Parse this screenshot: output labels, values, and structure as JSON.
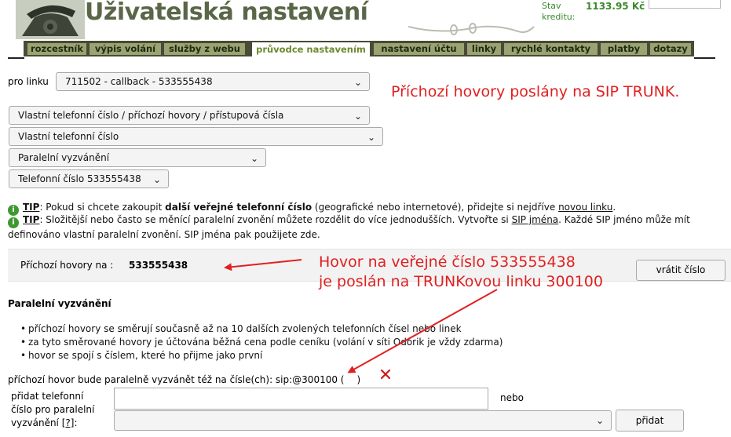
{
  "header": {
    "title": "Uživatelská nastavení",
    "credit_label": "Stav kreditu:",
    "credit_value": "1133.95 Kč"
  },
  "nav": {
    "tabs": [
      {
        "label": "rozcestník"
      },
      {
        "label": "výpis volání"
      },
      {
        "label": "služby z webu"
      },
      {
        "label": "průvodce nastavením",
        "active": true
      },
      {
        "label": "nastavení účtu"
      },
      {
        "label": "linky"
      },
      {
        "label": "rychlé kontakty"
      },
      {
        "label": "platby"
      },
      {
        "label": "dotazy"
      }
    ]
  },
  "line_select": {
    "label": "pro linku",
    "value": "711502 - callback - 533555438"
  },
  "annotation_top": "Příchozí hovory poslány na SIP TRUNK.",
  "wizard_selects": [
    {
      "value": "Vlastní telefonní číslo / příchozí hovory / přístupová čísla"
    },
    {
      "value": "Vlastní telefonní číslo"
    },
    {
      "value": "Paralelní vyzvánění"
    },
    {
      "value": "Telefonní číslo 533555438"
    }
  ],
  "tips": {
    "tip1": {
      "label": "TIP",
      "text_before": ": Pokud si chcete zakoupit ",
      "bold": "další veřejné telefonní číslo",
      "text_after": " (geografické nebo internetové), přidejte si nejdříve ",
      "link": "novou linku",
      "end": "."
    },
    "tip2": {
      "label": "TIP",
      "text_before": ": Složitější nebo často se měnící paralelní zvonění můžete rozdělit do více jednodušších. Vytvořte si ",
      "link": "SIP jména",
      "text_after": ". Každé SIP jméno může mít definováno vlastní paralelní zvonění. SIP jména pak použijete zde."
    }
  },
  "incoming": {
    "label": "Příchozí hovory na :",
    "number": "533555438",
    "return_button": "vrátit číslo"
  },
  "annotation_middle": {
    "line1": "Hovor na veřejné číslo 533555438",
    "line2": "je poslán na TRUNKovou linku 300100"
  },
  "parallel": {
    "title": "Paralelní vyzvánění",
    "bullets": [
      "příchozí hovory se směrují současně až na 10 dalších zvolených telefonních čísel nebo linek",
      "za tyto směrované hovory je účtována běžná cena podle ceníku (volání v síti Odorik je vždy zdarma)",
      "hovor se spojí s číslem, které ho přijme jako první"
    ],
    "sip_line_text": "příchozí hovor bude paralelně vyzvánět též na čísle(ch): sip:@300100 (",
    "sip_line_end": ")",
    "add_label_line1": "přidat telefonní",
    "add_label_line2": "číslo pro paralelní",
    "add_label_line3": "vyzvánění",
    "help_link": "[?]",
    "add_label_colon": ":",
    "phone_input_value": "",
    "or_text": "nebo",
    "sip_select_value": "",
    "add_button": "přidat"
  },
  "colors": {
    "annotation": "#e02020",
    "credit": "#3a8a2a",
    "nav_bg": "#4a4a36",
    "nav_tab": "#9aa372"
  }
}
